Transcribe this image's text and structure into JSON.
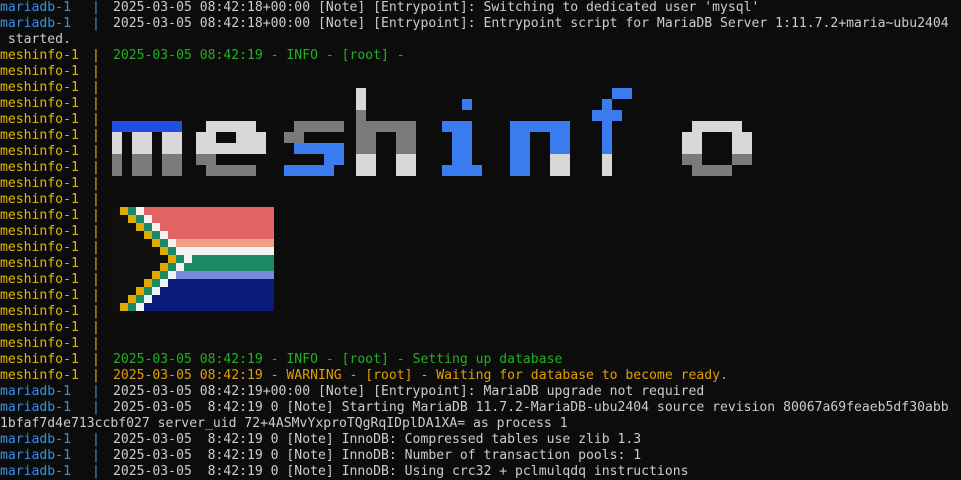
{
  "terminal": {
    "colors": {
      "background": "#0c0c0c",
      "text": "#cccccc",
      "mariadb_prefix": "#3b8eea",
      "meshinfo_prefix": "#e5b900",
      "info": "#23b024",
      "warning": "#e0a000"
    },
    "lines": [
      {
        "service": "mariadb-1",
        "sep": "|",
        "text": "2025-03-05 08:42:18+00:00 [Note] [Entrypoint]: Switching to dedicated user 'mysql'",
        "kind": "plain"
      },
      {
        "service": "mariadb-1",
        "sep": "|",
        "text": "2025-03-05 08:42:18+00:00 [Note] [Entrypoint]: Entrypoint script for MariaDB Server 1:11.7.2+maria~ubu2404",
        "kind": "plain"
      },
      {
        "service": "",
        "sep": "",
        "text": " started.",
        "kind": "plain"
      },
      {
        "service": "meshinfo-1",
        "sep": "|",
        "text": "2025-03-05 08:42:19 - INFO - [root] -",
        "kind": "info"
      },
      {
        "service": "meshinfo-1",
        "sep": "|",
        "text": "",
        "kind": "plain"
      },
      {
        "service": "meshinfo-1",
        "sep": "|",
        "text": "",
        "kind": "plain"
      },
      {
        "service": "meshinfo-1",
        "sep": "|",
        "text": "",
        "kind": "plain"
      },
      {
        "service": "meshinfo-1",
        "sep": "|",
        "text": "",
        "kind": "plain"
      },
      {
        "service": "meshinfo-1",
        "sep": "|",
        "text": "",
        "kind": "plain"
      },
      {
        "service": "meshinfo-1",
        "sep": "|",
        "text": "",
        "kind": "plain"
      },
      {
        "service": "meshinfo-1",
        "sep": "|",
        "text": "",
        "kind": "plain"
      },
      {
        "service": "meshinfo-1",
        "sep": "|",
        "text": "",
        "kind": "plain"
      },
      {
        "service": "meshinfo-1",
        "sep": "|",
        "text": "",
        "kind": "plain"
      },
      {
        "service": "meshinfo-1",
        "sep": "|",
        "text": "",
        "kind": "plain"
      },
      {
        "service": "meshinfo-1",
        "sep": "|",
        "text": "",
        "kind": "plain"
      },
      {
        "service": "meshinfo-1",
        "sep": "|",
        "text": "",
        "kind": "plain"
      },
      {
        "service": "meshinfo-1",
        "sep": "|",
        "text": "",
        "kind": "plain"
      },
      {
        "service": "meshinfo-1",
        "sep": "|",
        "text": "",
        "kind": "plain"
      },
      {
        "service": "meshinfo-1",
        "sep": "|",
        "text": "",
        "kind": "plain"
      },
      {
        "service": "meshinfo-1",
        "sep": "|",
        "text": "",
        "kind": "plain"
      },
      {
        "service": "meshinfo-1",
        "sep": "|",
        "text": "",
        "kind": "plain"
      },
      {
        "service": "meshinfo-1",
        "sep": "|",
        "text": "",
        "kind": "plain"
      },
      {
        "service": "meshinfo-1",
        "sep": "|",
        "text": "2025-03-05 08:42:19 - INFO - [root] - Setting up database",
        "kind": "info"
      },
      {
        "service": "meshinfo-1",
        "sep": "|",
        "text": "2025-03-05 08:42:19 - WARNING - [root] - Waiting for database to become ready.",
        "kind": "warn"
      },
      {
        "service": "mariadb-1",
        "sep": "|",
        "text": "2025-03-05 08:42:19+00:00 [Note] [Entrypoint]: MariaDB upgrade not required",
        "kind": "plain"
      },
      {
        "service": "mariadb-1",
        "sep": "|",
        "text": "2025-03-05  8:42:19 0 [Note] Starting MariaDB 11.7.2-MariaDB-ubu2404 source revision 80067a69feaeb5df30abb",
        "kind": "plain"
      },
      {
        "service": "",
        "sep": "",
        "text": "1bfaf7d4e713ccbf027 server_uid 72+4ASMvYxproTQgRqIDplDA1XA= as process 1",
        "kind": "plain"
      },
      {
        "service": "mariadb-1",
        "sep": "|",
        "text": "2025-03-05  8:42:19 0 [Note] InnoDB: Compressed tables use zlib 1.3",
        "kind": "plain"
      },
      {
        "service": "mariadb-1",
        "sep": "|",
        "text": "2025-03-05  8:42:19 0 [Note] InnoDB: Number of transaction pools: 1",
        "kind": "plain"
      },
      {
        "service": "mariadb-1",
        "sep": "|",
        "text": "2025-03-05  8:42:19 0 [Note] InnoDB: Using crc32 + pclmulqdq instructions",
        "kind": "plain"
      }
    ]
  },
  "banner": {
    "text": "meshinfo",
    "colors": [
      "#1f4fe0",
      "#d8d8d8",
      "#7a7a7a",
      "#3a7bf0"
    ]
  },
  "flag": {
    "name": "South Africa",
    "colors": {
      "red": "#e06464",
      "white": "#f2f2f2",
      "green": "#1a8a66",
      "gold": "#e0a800",
      "black": "#101010",
      "blue": "#0a1a7a",
      "salmon": "#f0a088",
      "lightblue": "#7a8ae0"
    }
  }
}
